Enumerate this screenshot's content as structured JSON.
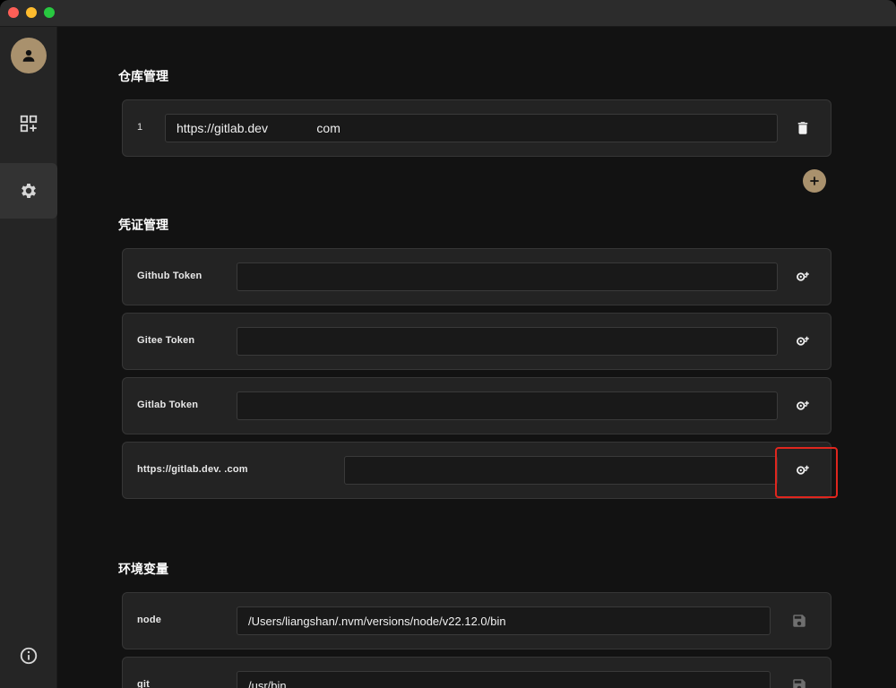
{
  "sidebar": {
    "items": [
      {
        "name": "apps-add",
        "icon": "apps-add-icon"
      },
      {
        "name": "settings",
        "icon": "gear-icon",
        "active": true
      },
      {
        "name": "info",
        "icon": "info-icon"
      }
    ]
  },
  "repo": {
    "title": "仓库管理",
    "rows": [
      {
        "index": "1",
        "url": "https://gitlab.dev              com"
      }
    ]
  },
  "credentials": {
    "title": "凭证管理",
    "rows": [
      {
        "label": "Github Token",
        "value": ""
      },
      {
        "label": "Gitee Token",
        "value": ""
      },
      {
        "label": "Gitlab Token",
        "value": ""
      },
      {
        "label": "https://gitlab.dev.              .com",
        "value": ""
      }
    ]
  },
  "env": {
    "title": "环境变量",
    "rows": [
      {
        "label": "node",
        "value": "/Users/liangshan/.nvm/versions/node/v22.12.0/bin"
      },
      {
        "label": "git",
        "value": "/usr/bin"
      }
    ]
  },
  "colors": {
    "accent": "#a9916d",
    "highlight": "#e0261e"
  }
}
